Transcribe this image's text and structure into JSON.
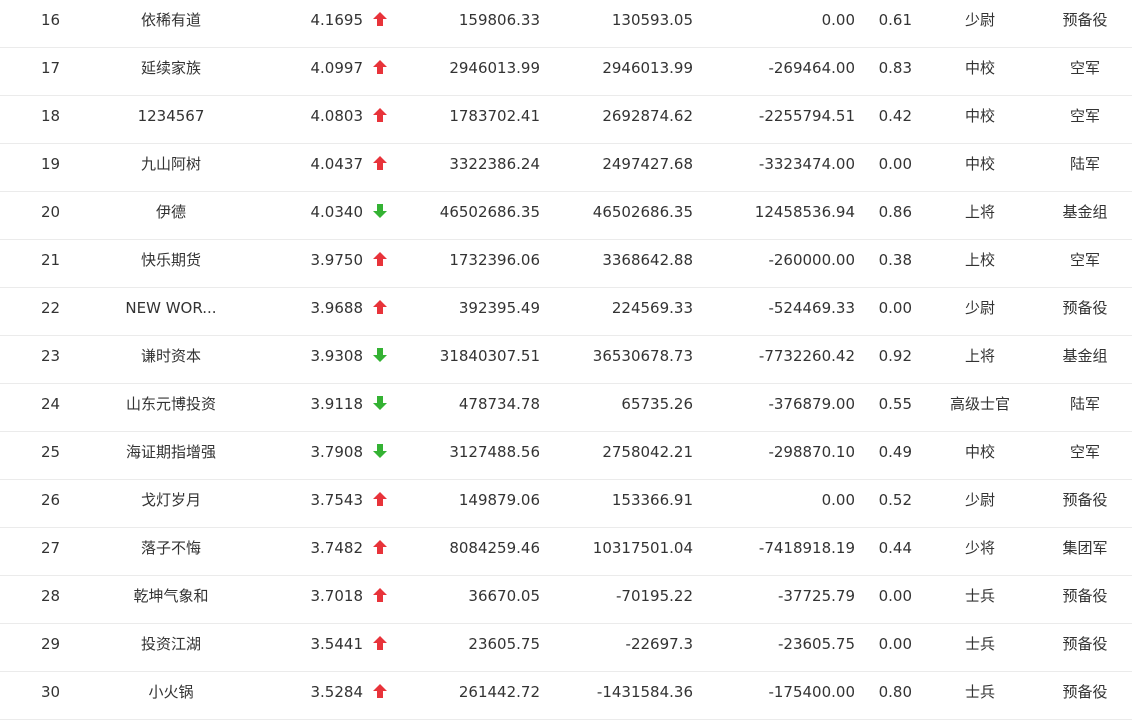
{
  "colors": {
    "up": "#e8333a",
    "down": "#34b233",
    "text": "#333333",
    "divider": "#ebebeb"
  },
  "rows": [
    {
      "rank": "16",
      "name": "依稀有道",
      "score": "4.1695",
      "trend": "up",
      "v1": "159806.33",
      "v2": "130593.05",
      "v3": "0.00",
      "ratio": "0.61",
      "title": "少尉",
      "group": "预备役"
    },
    {
      "rank": "17",
      "name": "延续家族",
      "score": "4.0997",
      "trend": "up",
      "v1": "2946013.99",
      "v2": "2946013.99",
      "v3": "-269464.00",
      "ratio": "0.83",
      "title": "中校",
      "group": "空军"
    },
    {
      "rank": "18",
      "name": "1234567",
      "score": "4.0803",
      "trend": "up",
      "v1": "1783702.41",
      "v2": "2692874.62",
      "v3": "-2255794.51",
      "ratio": "0.42",
      "title": "中校",
      "group": "空军"
    },
    {
      "rank": "19",
      "name": "九山阿树",
      "score": "4.0437",
      "trend": "up",
      "v1": "3322386.24",
      "v2": "2497427.68",
      "v3": "-3323474.00",
      "ratio": "0.00",
      "title": "中校",
      "group": "陆军"
    },
    {
      "rank": "20",
      "name": "伊德",
      "score": "4.0340",
      "trend": "down",
      "v1": "46502686.35",
      "v2": "46502686.35",
      "v3": "12458536.94",
      "ratio": "0.86",
      "title": "上将",
      "group": "基金组"
    },
    {
      "rank": "21",
      "name": "快乐期货",
      "score": "3.9750",
      "trend": "up",
      "v1": "1732396.06",
      "v2": "3368642.88",
      "v3": "-260000.00",
      "ratio": "0.38",
      "title": "上校",
      "group": "空军"
    },
    {
      "rank": "22",
      "name": "NEW WOR...",
      "score": "3.9688",
      "trend": "up",
      "v1": "392395.49",
      "v2": "224569.33",
      "v3": "-524469.33",
      "ratio": "0.00",
      "title": "少尉",
      "group": "预备役"
    },
    {
      "rank": "23",
      "name": "谦时资本",
      "score": "3.9308",
      "trend": "down",
      "v1": "31840307.51",
      "v2": "36530678.73",
      "v3": "-7732260.42",
      "ratio": "0.92",
      "title": "上将",
      "group": "基金组"
    },
    {
      "rank": "24",
      "name": "山东元博投资",
      "score": "3.9118",
      "trend": "down",
      "v1": "478734.78",
      "v2": "65735.26",
      "v3": "-376879.00",
      "ratio": "0.55",
      "title": "高级士官",
      "group": "陆军"
    },
    {
      "rank": "25",
      "name": "海证期指增强",
      "score": "3.7908",
      "trend": "down",
      "v1": "3127488.56",
      "v2": "2758042.21",
      "v3": "-298870.10",
      "ratio": "0.49",
      "title": "中校",
      "group": "空军"
    },
    {
      "rank": "26",
      "name": "戈灯岁月",
      "score": "3.7543",
      "trend": "up",
      "v1": "149879.06",
      "v2": "153366.91",
      "v3": "0.00",
      "ratio": "0.52",
      "title": "少尉",
      "group": "预备役"
    },
    {
      "rank": "27",
      "name": "落子不悔",
      "score": "3.7482",
      "trend": "up",
      "v1": "8084259.46",
      "v2": "10317501.04",
      "v3": "-7418918.19",
      "ratio": "0.44",
      "title": "少将",
      "group": "集团军"
    },
    {
      "rank": "28",
      "name": "乾坤气象和",
      "score": "3.7018",
      "trend": "up",
      "v1": "36670.05",
      "v2": "-70195.22",
      "v3": "-37725.79",
      "ratio": "0.00",
      "title": "士兵",
      "group": "预备役"
    },
    {
      "rank": "29",
      "name": "投资江湖",
      "score": "3.5441",
      "trend": "up",
      "v1": "23605.75",
      "v2": "-22697.3",
      "v3": "-23605.75",
      "ratio": "0.00",
      "title": "士兵",
      "group": "预备役"
    },
    {
      "rank": "30",
      "name": "小火锅",
      "score": "3.5284",
      "trend": "up",
      "v1": "261442.72",
      "v2": "-1431584.36",
      "v3": "-175400.00",
      "ratio": "0.80",
      "title": "士兵",
      "group": "预备役"
    }
  ]
}
